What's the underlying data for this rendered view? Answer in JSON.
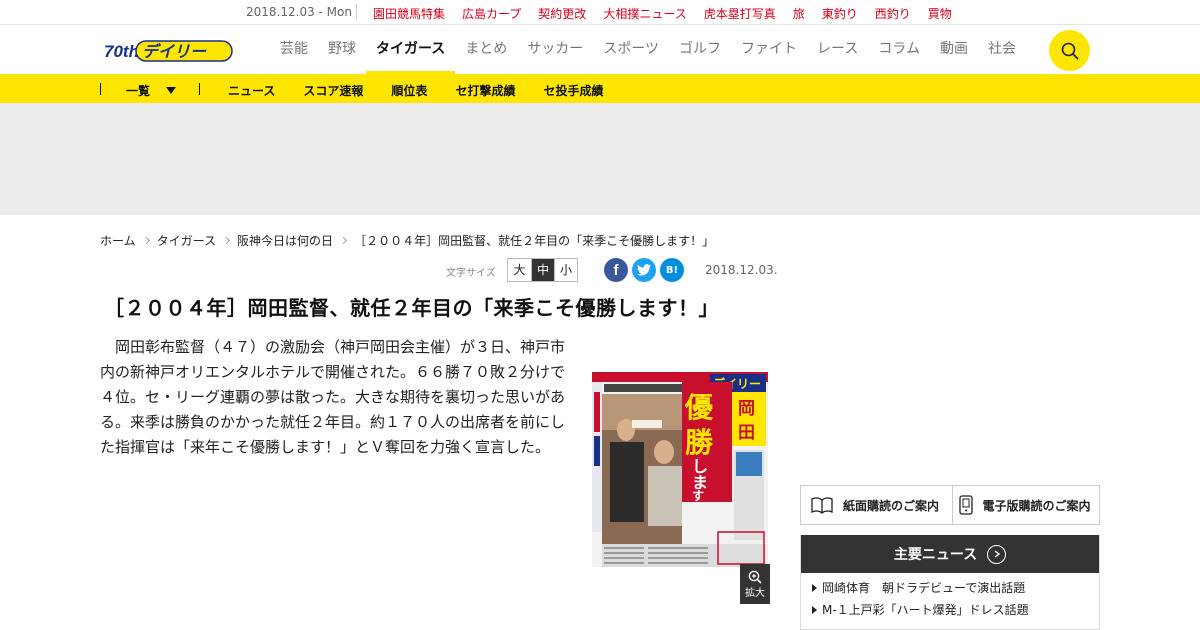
{
  "topbar": {
    "date": "2018.12.03 - Mon",
    "links": [
      "園田競馬特集",
      "広島カープ",
      "契約更改",
      "大相撲ニュース",
      "虎本塁打写真",
      "旅",
      "東釣り",
      "西釣り",
      "買物"
    ]
  },
  "logo": {
    "badge": "70th",
    "text": "デイリー"
  },
  "nav": {
    "items": [
      "芸能",
      "野球",
      "タイガース",
      "まとめ",
      "サッカー",
      "スポーツ",
      "ゴルフ",
      "ファイト",
      "レース",
      "コラム",
      "動画",
      "社会"
    ],
    "active": "タイガース"
  },
  "subnav": {
    "list_label": "一覧",
    "items": [
      "ニュース",
      "スコア速報",
      "順位表",
      "セ打撃成績",
      "セ投手成績"
    ]
  },
  "breadcrumb": [
    "ホーム",
    "タイガース",
    "阪神今日は何の日",
    "［２００４年］岡田監督、就任２年目の「来季こそ優勝します！」"
  ],
  "font_size": {
    "label": "文字サイズ",
    "large": "大",
    "medium": "中",
    "small": "小"
  },
  "share": {
    "facebook": "f",
    "hatena": "B!"
  },
  "article": {
    "date": "2018.12.03.",
    "headline": "［２００４年］岡田監督、就任２年目の「来季こそ優勝します！」",
    "body": "岡田彰布監督（４７）の激励会（神戸岡田会主催）が３日、神戸市内の新神戸オリエンタルホテルで開催された。６６勝７０敗２分けで４位。セ・リーグ連覇の夢は散った。大きな期待を裏切った思いがある。来季は勝負のかかった就任２年目。約１７０人の出席者を前にした指揮官は「来年こそ優勝します！」とＶ奪回を力強く宣言した。",
    "zoom_label": "拡大"
  },
  "newspaper": {
    "masthead": "デイリー",
    "headline_chars": [
      "優",
      "勝",
      "し",
      "ま",
      "す"
    ],
    "name_chars": [
      "岡",
      "田"
    ]
  },
  "sidebar": {
    "paper_sub": "紙面購読のご案内",
    "digital_sub": "電子版購読のご案内",
    "main_news_title": "主要ニュース",
    "news": [
      "岡崎体育　朝ドラデビューで演出話題",
      "M-１上戸彩「ハート爆発」ドレス話題"
    ]
  },
  "colors": {
    "brand_yellow": "#ffe600",
    "link_red": "#d8001c",
    "facebook": "#3b5998",
    "twitter": "#1da1f2",
    "hatena": "#008fde"
  }
}
